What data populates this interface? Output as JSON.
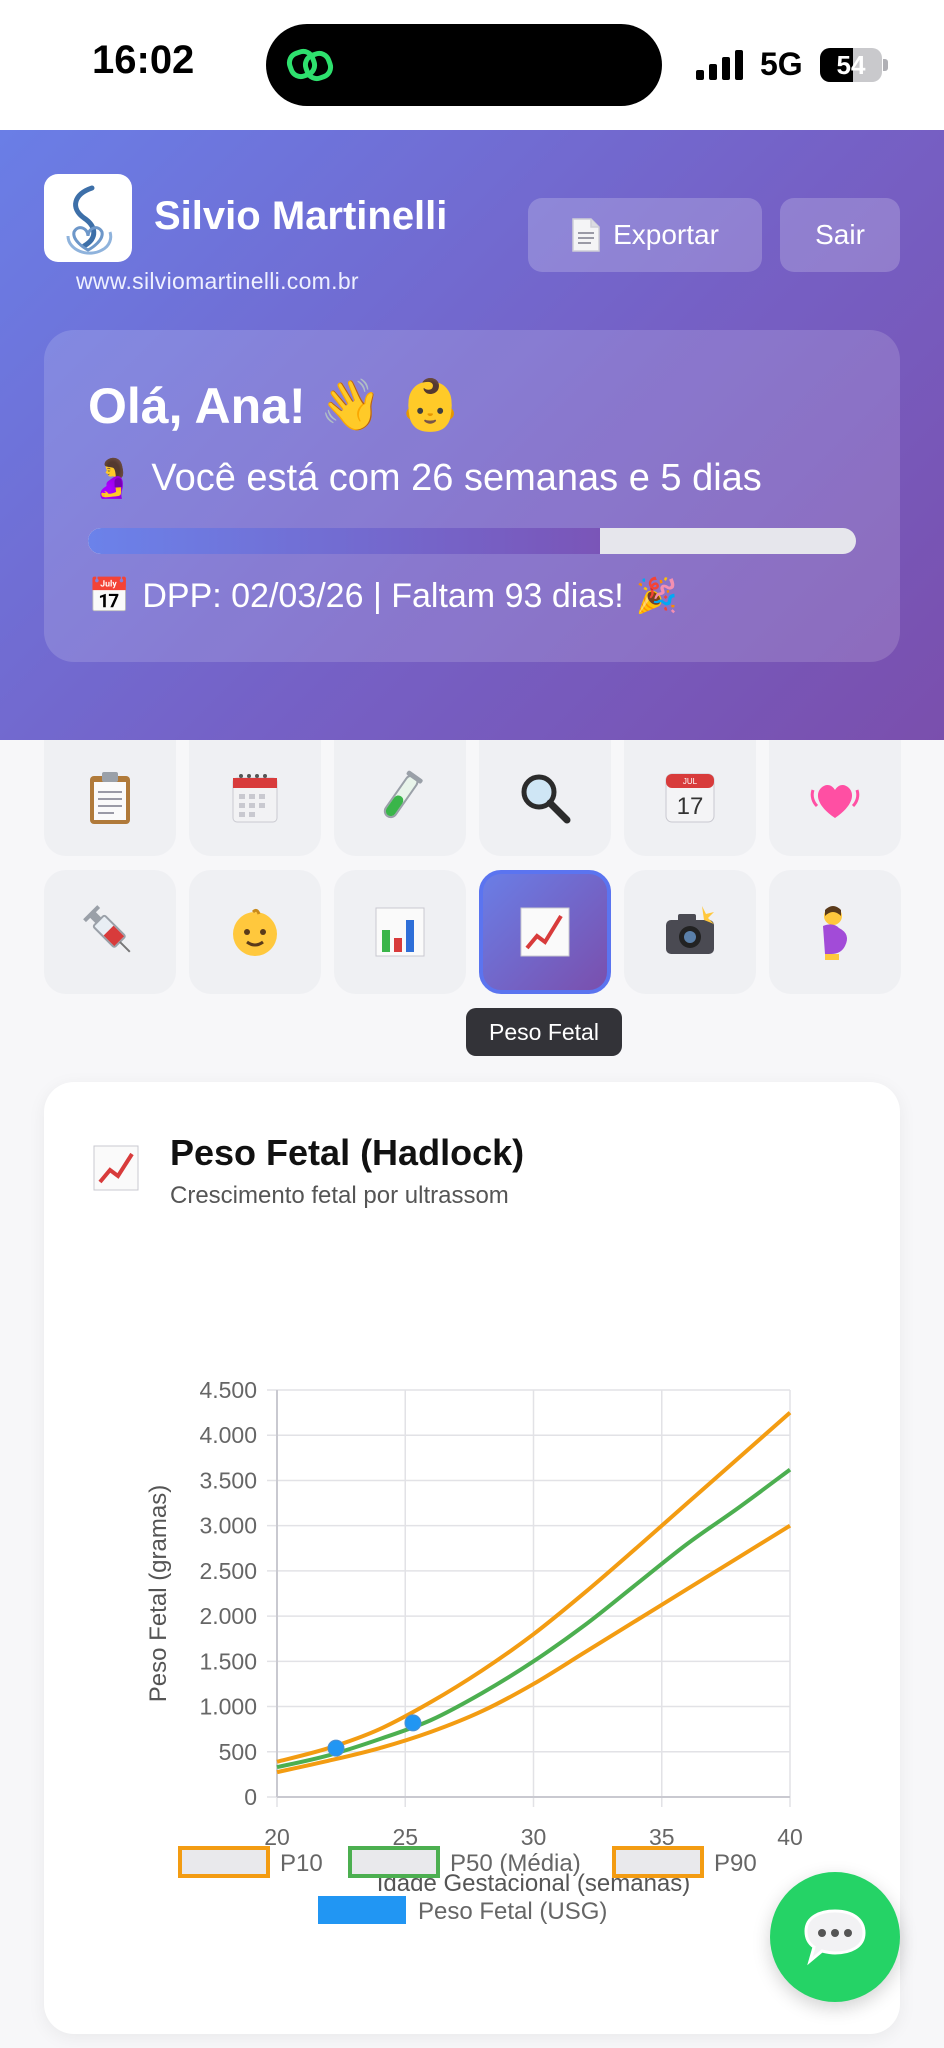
{
  "status_bar": {
    "time": "16:02",
    "network": "5G",
    "battery": "54",
    "battery_level": 0.54
  },
  "header": {
    "brand_name": "Silvio Martinelli",
    "brand_url": "www.silviomartinelli.com.br",
    "export_label": "Exportar",
    "exit_label": "Sair",
    "greeting": "Olá, Ana!",
    "greeting_emoji": "👋 👶",
    "weeks_emoji": "🤰",
    "weeks_text": "Você está com 26 semanas e 5 dias",
    "progress": 0.667,
    "dpp_emoji": "📅",
    "dpp_text": "DPP: 02/03/26 | Faltam 93 dias!",
    "dpp_end_emoji": "🎉"
  },
  "grid": {
    "row1": [
      "clipboard-icon",
      "calendar-spiral-icon",
      "test-tube-icon",
      "magnifier-icon",
      "calendar-icon",
      "heart-icon"
    ],
    "row2": [
      "syringe-icon",
      "baby-icon",
      "bar-chart-icon",
      "line-chart-icon",
      "camera-flash-icon",
      "pregnant-icon"
    ],
    "active": "line-chart-icon",
    "tooltip": "Peso Fetal"
  },
  "card": {
    "title": "Peso Fetal (Hadlock)",
    "subtitle": "Crescimento fetal por ultrassom"
  },
  "colors": {
    "p10": "#f39c12",
    "p50": "#4caf50",
    "p90": "#f39c12",
    "usg": "#2196f3"
  },
  "chart_data": {
    "type": "line",
    "xlabel": "Idade Gestacional (semanas)",
    "ylabel": "Peso Fetal (gramas)",
    "xlim": [
      20,
      40
    ],
    "ylim": [
      0,
      4500
    ],
    "xticks": [
      "20",
      "25",
      "30",
      "35",
      "40"
    ],
    "yticks": [
      "0",
      "500",
      "1.000",
      "1.500",
      "2.000",
      "2.500",
      "3.000",
      "3.500",
      "4.000",
      "4.500"
    ],
    "series": [
      {
        "name": "P10",
        "x": [
          20,
          22,
          24,
          26,
          28,
          30,
          32,
          34,
          36,
          38,
          40
        ],
        "values": [
          275,
          400,
          540,
          720,
          950,
          1250,
          1600,
          1950,
          2300,
          2650,
          3000
        ]
      },
      {
        "name": "P50 (Média)",
        "x": [
          20,
          22,
          24,
          26,
          28,
          30,
          32,
          34,
          36,
          38,
          40
        ],
        "values": [
          330,
          460,
          640,
          850,
          1150,
          1500,
          1900,
          2350,
          2800,
          3200,
          3620
        ]
      },
      {
        "name": "P90",
        "x": [
          20,
          22,
          24,
          26,
          28,
          30,
          32,
          34,
          36,
          38,
          40
        ],
        "values": [
          390,
          540,
          750,
          1050,
          1400,
          1800,
          2260,
          2750,
          3250,
          3750,
          4250
        ]
      },
      {
        "name": "Peso Fetal (USG)",
        "x": [
          22.3,
          25.3
        ],
        "values": [
          540,
          820
        ]
      }
    ],
    "legend": "bottom",
    "grid": true
  }
}
